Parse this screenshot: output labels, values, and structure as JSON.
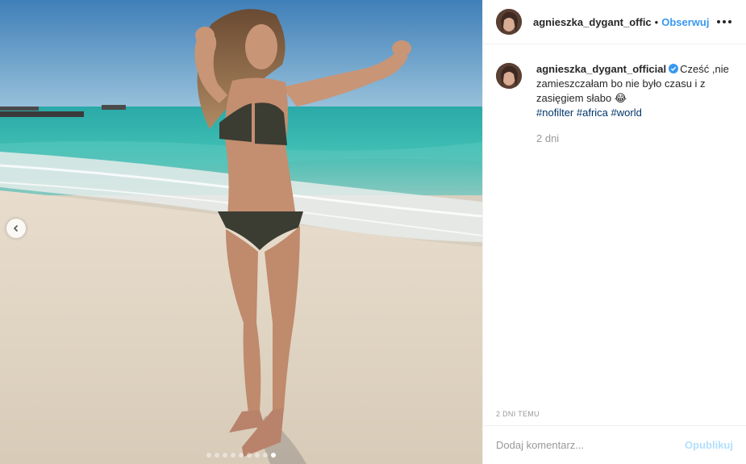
{
  "post": {
    "username_header": "agnieszka_dygant_offic",
    "separator": "•",
    "follow_label": "Obserwuj",
    "photo": {
      "alt": "beach photo",
      "carousel_dot_count": 9,
      "carousel_active_index": 8
    },
    "caption": {
      "username": "agnieszka_dygant_official",
      "verified": true,
      "text": "Cześć ,nie zamieszczałam bo nie było czasu i z zasięgiem słabo 😂",
      "hashtags": [
        "#nofilter",
        "#africa",
        "#world"
      ],
      "time_ago": "2 dni"
    },
    "timestamp": "2 DNI TEMU",
    "comment_input": {
      "placeholder": "Dodaj komentarz...",
      "value": ""
    },
    "publish_label": "Opublikuj"
  },
  "colors": {
    "link": "#3897f0",
    "hashtag": "#003569",
    "muted": "#999999",
    "publish_disabled": "#b2dffc",
    "verified_badge": "#3897f0"
  }
}
